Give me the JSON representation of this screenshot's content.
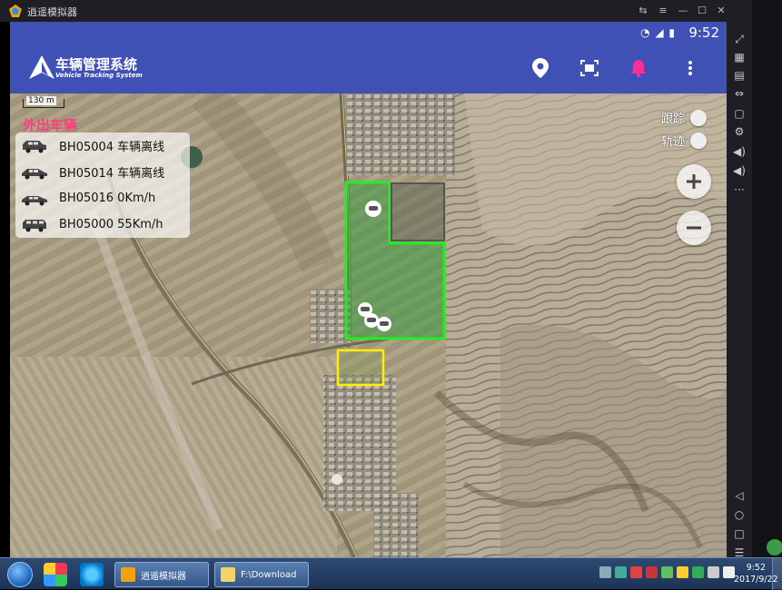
{
  "emulator": {
    "title": "逍遥模拟器",
    "controls": [
      "⇆",
      "≡",
      "—",
      "☐",
      "✕",
      "‹‹‹"
    ],
    "side_buttons": [
      "⤢",
      "▦",
      "▤",
      "⇔",
      "▢",
      "⚙",
      "◀)",
      "◀)",
      "···",
      "◁",
      "○",
      "□",
      "☰"
    ]
  },
  "status_bar": {
    "time": "9:52",
    "icons": "◔ ◢ ▮"
  },
  "app": {
    "title": "车辆管理系统",
    "subtitle": "Vehicle Tracking System",
    "actions": [
      "location-icon",
      "fullscreen-icon",
      "bell-icon",
      "more-icon"
    ],
    "accent": "#3f51b5",
    "bell_color": "#ff2d9a"
  },
  "map": {
    "scale_label": "130 m",
    "panel_title": "外出车辆",
    "vehicles": [
      {
        "text": "BH05004 车辆离线",
        "type": "suv"
      },
      {
        "text": "BH05014 车辆离线",
        "type": "sedan"
      },
      {
        "text": "BH05016 0Km/h",
        "type": "sedan"
      },
      {
        "text": "BH05000 55Km/h",
        "type": "van"
      }
    ],
    "toggles": [
      {
        "label": "跟踪",
        "on": false
      },
      {
        "label": "轨迹",
        "on": false
      }
    ],
    "zoom_in": "+",
    "zoom_out": "−",
    "fence_colors": {
      "primary": "#22ee22",
      "secondary": "#ffee00",
      "tertiary": "#555555"
    }
  },
  "taskbar": {
    "tasks": [
      "逍遥模拟器",
      "F:\\Download"
    ],
    "clock_time": "9:52",
    "clock_date": "2017/9/22"
  }
}
